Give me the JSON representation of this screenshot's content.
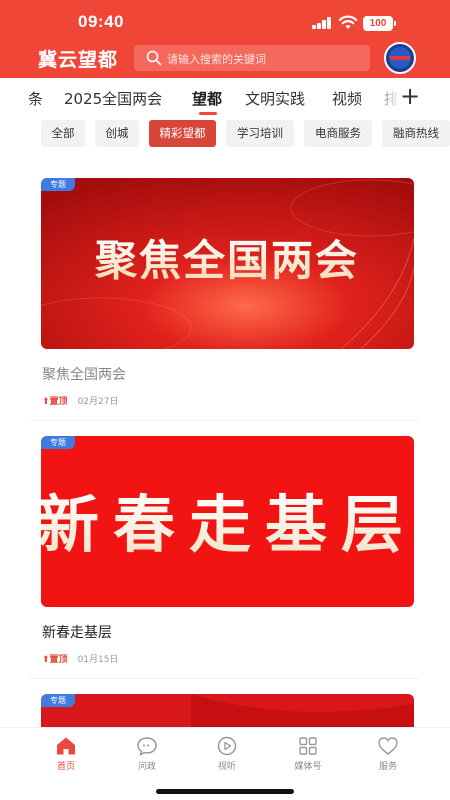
{
  "status_bar": {
    "time": "09:40",
    "battery": "100"
  },
  "header": {
    "app_title": "冀云望都",
    "search_placeholder": "请输入搜索的关键词",
    "avatar_icon": "user-avatar-icon"
  },
  "channels": {
    "items": [
      "条",
      "2025全国两会",
      "望都",
      "文明实践",
      "视频",
      "排"
    ],
    "active_index": 2,
    "add_label": "+"
  },
  "chips": {
    "items": [
      "全部",
      "创城",
      "精彩望都",
      "学习培训",
      "电商服务",
      "融商热线"
    ],
    "active_index": 2
  },
  "cards": [
    {
      "badge": "专题",
      "image_text": "聚焦全国两会",
      "title": "聚焦全国两会",
      "pin_label": "置顶",
      "date": "02月27日"
    },
    {
      "badge": "专题",
      "image_text": "新春走基层",
      "title": "新春走基层",
      "pin_label": "置顶",
      "date": "01月15日"
    },
    {
      "badge": "专题"
    }
  ],
  "tabbar": {
    "items": [
      {
        "label": "首页",
        "icon": "home-icon"
      },
      {
        "label": "问政",
        "icon": "chat-icon"
      },
      {
        "label": "视听",
        "icon": "play-icon"
      },
      {
        "label": "媒体号",
        "icon": "grid-icon"
      },
      {
        "label": "服务",
        "icon": "heart-icon"
      }
    ],
    "active_index": 0
  },
  "colors": {
    "brand_red": "#ef4637",
    "badge_blue": "#3f7be0",
    "active_red": "#e84a3c"
  }
}
